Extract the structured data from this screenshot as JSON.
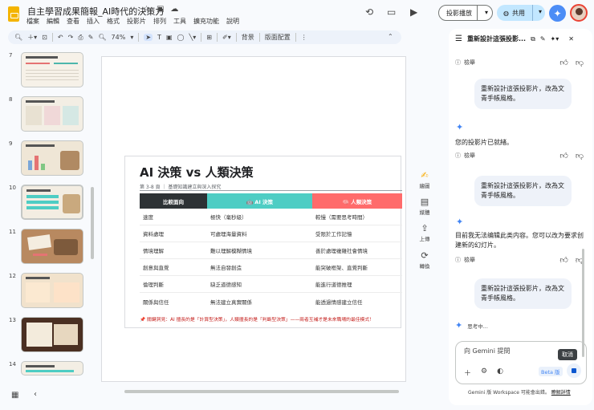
{
  "app": {
    "title": "自主學習成果簡報_AI時代的決策力",
    "title_icons": [
      "☆",
      "▣",
      "☁"
    ],
    "menu": [
      "檔案",
      "編輯",
      "查看",
      "插入",
      "格式",
      "投影片",
      "排列",
      "工具",
      "擴充功能",
      "說明"
    ],
    "present_label": "投影播放",
    "share_label": "共用"
  },
  "toolbar": {
    "zoom": "74%",
    "background_label": "背景",
    "layout_label": "版面配置"
  },
  "filmstrip": {
    "numbers": [
      "7",
      "8",
      "9",
      "10",
      "11",
      "12",
      "13",
      "14"
    ]
  },
  "slide": {
    "title": "AI 決策 vs 人類決策",
    "subtitle": "第 3-8 頁 ｜ 基礎知識建立與深入探究",
    "headers": [
      "比較面向",
      "🤖 AI 決策",
      "🧠 人類決策"
    ],
    "header_colors": [
      "#2d3235",
      "#4ecdc4",
      "#ff6b6b"
    ],
    "rows": [
      [
        "速度",
        "極快（毫秒級）",
        "較慢（需要思考時間）"
      ],
      [
        "資料處理",
        "可處理海量資料",
        "受限於工作記憶"
      ],
      [
        "情境理解",
        "難以理解模糊情境",
        "善於處理複雜社會情境"
      ],
      [
        "創意與直覺",
        "無法自發創造",
        "能突破框架、直覺判斷"
      ],
      [
        "倫理判斷",
        "缺乏道德感知",
        "能進行道德推理"
      ],
      [
        "關係與信任",
        "無法建立真實關係",
        "能透過情感建立信任"
      ]
    ],
    "note": "📌 關鍵洞見：AI 擅長的是「計算型決策」，人類擅長的是「判斷型決策」——兩者互補才是未來職場的最佳模式！"
  },
  "rail": [
    {
      "icon": "✍",
      "label": "繪圖"
    },
    {
      "icon": "▤",
      "label": "媒體"
    },
    {
      "icon": "⇪",
      "label": "上傳"
    },
    {
      "icon": "⟳",
      "label": "轉換"
    }
  ],
  "gemini": {
    "panel_title": "重新設計這張投影...",
    "report_label": "檢舉",
    "user_msg_1": "重新設計這張投影片，改為文青手帳風格。",
    "bot_msg_1": "您的投影片已就緒。",
    "user_msg_2": "重新設計這張投影片，改為文青手帳風格。",
    "bot_msg_2": "目前我无法编辑此类内容。您可以改为要求创建新的幻灯片。",
    "user_msg_3": "重新設計這張投影片，改為文青手帳風格。",
    "thinking_label": "思考中...",
    "input_placeholder": "向 Gemini 提問",
    "beta_label": "Beta 版",
    "tooltip": "取消",
    "footer_text": "Gemini 版 Workspace 可能會出錯。",
    "footer_link": "瞭解詳情"
  }
}
